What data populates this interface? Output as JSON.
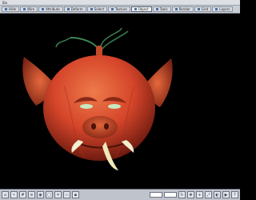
{
  "window": {
    "title": "Bix"
  },
  "menubar": {
    "tabs": [
      {
        "label": "Hide",
        "active": false
      },
      {
        "label": "Wire",
        "active": false
      },
      {
        "label": "Attribute",
        "active": false
      },
      {
        "label": "Deform",
        "active": false
      },
      {
        "label": "Select",
        "active": false
      },
      {
        "label": "Texture",
        "active": false
      },
      {
        "label": "Object",
        "active": true
      },
      {
        "label": "Tools",
        "active": false
      },
      {
        "label": "Render",
        "active": false
      },
      {
        "label": "Grid",
        "active": false
      },
      {
        "label": "Layers",
        "active": false
      }
    ]
  },
  "viewport": {
    "background": "#000000",
    "object": "demon-pumpkin-head",
    "skin_color": "#d5452a",
    "stem_color": "#3f8a55"
  },
  "statusbar": {
    "left_icons": [
      "home-icon",
      "pin-icon",
      "grid-icon",
      "layer-icon",
      "camera-icon",
      "box-icon",
      "light-icon",
      "folder-icon",
      "save-icon"
    ],
    "right_icons": [
      "rotate-icon",
      "move-icon",
      "zoom-icon",
      "fit-icon",
      "view-icon",
      "render-icon",
      "help-icon"
    ],
    "fields": [
      "",
      ""
    ]
  }
}
